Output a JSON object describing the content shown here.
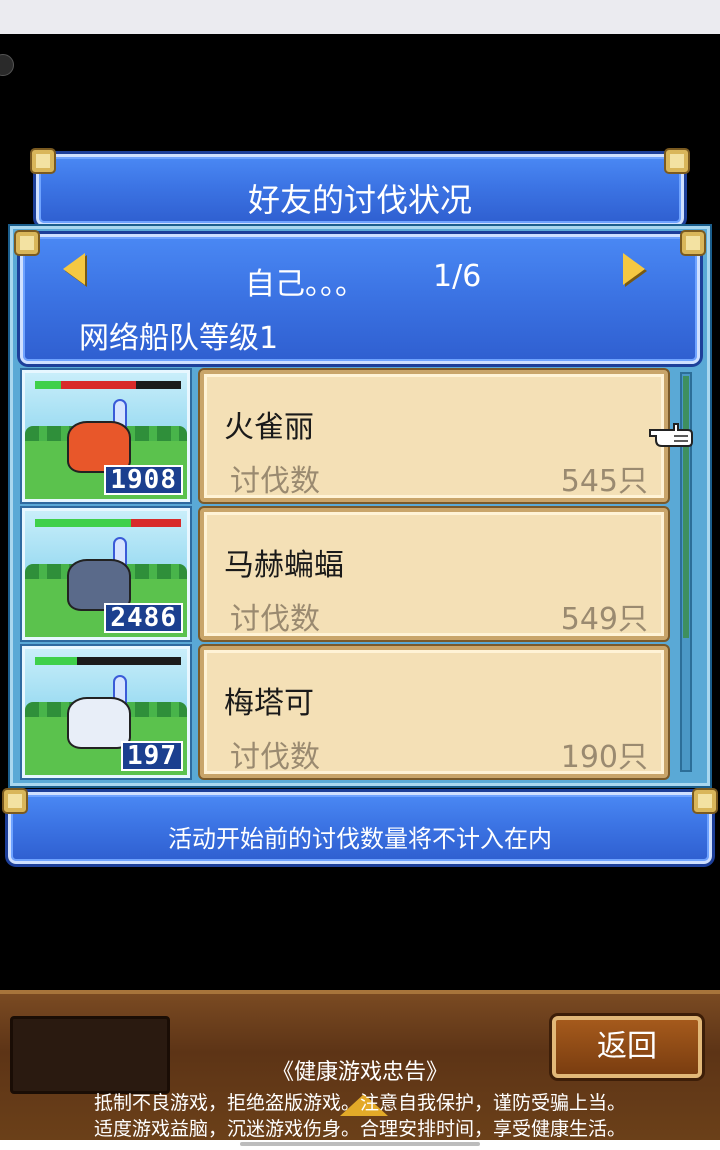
{
  "title": "好友的讨伐状况",
  "header": {
    "friend_name": "自己。。。",
    "page": "1/6",
    "fleet_level": "网络船队等级1"
  },
  "monsters": [
    {
      "name": "火雀丽",
      "kill_label": "讨伐数",
      "kills": "545只",
      "card_number": "1908",
      "hp_green": 0.18,
      "hp_red": 0.51,
      "color": "#e8572a"
    },
    {
      "name": "马赫蝙蝠",
      "kill_label": "讨伐数",
      "kills": "549只",
      "card_number": "2486",
      "hp_green": 0.66,
      "hp_red": 0.34,
      "color": "#5a6a8a"
    },
    {
      "name": "梅塔可",
      "kill_label": "讨伐数",
      "kills": "190只",
      "card_number": "197",
      "hp_green": 0.29,
      "hp_red": 0.0,
      "color": "#e8eef8"
    }
  ],
  "notice": "活动开始前的讨伐数量将不计入在内",
  "bottom": {
    "back_label": "返回",
    "advisory_title": "《健康游戏忠告》",
    "advisory_line1": "抵制不良游戏，拒绝盗版游戏。注意自我保护，谨防受骗上当。",
    "advisory_line2": "适度游戏益脑，沉迷游戏伤身。合理安排时间，享受健康生活。"
  },
  "icons": {
    "prev": "left-arrow-icon",
    "next": "right-arrow-icon",
    "pointer": "pointing-hand-icon"
  }
}
